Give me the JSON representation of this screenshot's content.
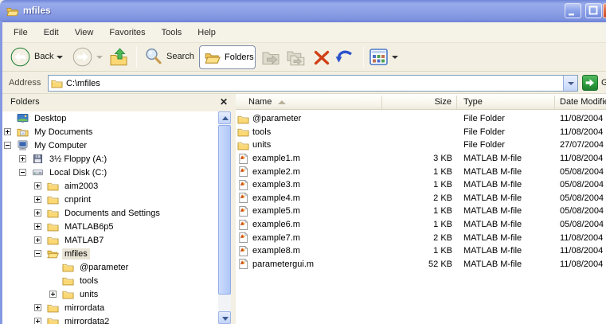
{
  "window": {
    "title": "mfiles"
  },
  "menu": {
    "items": [
      "File",
      "Edit",
      "View",
      "Favorites",
      "Tools",
      "Help"
    ]
  },
  "toolbar": {
    "back_label": "Back",
    "search_label": "Search",
    "folders_label": "Folders",
    "buttons": [
      "back",
      "forward",
      "up",
      "search",
      "folders",
      "move-to",
      "copy-to",
      "delete",
      "undo",
      "views"
    ]
  },
  "address_bar": {
    "label": "Address",
    "path": "C:\\mfiles",
    "go_label": "Go"
  },
  "folders_pane": {
    "title": "Folders",
    "close_icon": "✕",
    "tree": [
      {
        "label": "Desktop",
        "level": 0,
        "expander": null,
        "icon": "desktop",
        "selected": false
      },
      {
        "label": "My Documents",
        "level": 1,
        "expander": "+",
        "icon": "my-documents",
        "selected": false
      },
      {
        "label": "My Computer",
        "level": 1,
        "expander": "-",
        "icon": "my-computer",
        "selected": false
      },
      {
        "label": "3½ Floppy (A:)",
        "level": 2,
        "expander": "+",
        "icon": "floppy-drive",
        "selected": false
      },
      {
        "label": "Local Disk (C:)",
        "level": 2,
        "expander": "-",
        "icon": "local-disk",
        "selected": false
      },
      {
        "label": "aim2003",
        "level": 3,
        "expander": "+",
        "icon": "folder",
        "selected": false
      },
      {
        "label": "cnprint",
        "level": 3,
        "expander": "+",
        "icon": "folder",
        "selected": false
      },
      {
        "label": "Documents and Settings",
        "level": 3,
        "expander": "+",
        "icon": "folder",
        "selected": false
      },
      {
        "label": "MATLAB6p5",
        "level": 3,
        "expander": "+",
        "icon": "folder",
        "selected": false
      },
      {
        "label": "MATLAB7",
        "level": 3,
        "expander": "+",
        "icon": "folder",
        "selected": false
      },
      {
        "label": "mfiles",
        "level": 3,
        "expander": "-",
        "icon": "folder-open",
        "selected": true
      },
      {
        "label": "@parameter",
        "level": 4,
        "expander": null,
        "icon": "folder",
        "selected": false
      },
      {
        "label": "tools",
        "level": 4,
        "expander": null,
        "icon": "folder",
        "selected": false
      },
      {
        "label": "units",
        "level": 4,
        "expander": "+",
        "icon": "folder",
        "selected": false
      },
      {
        "label": "mirrordata",
        "level": 3,
        "expander": "+",
        "icon": "folder",
        "selected": false
      },
      {
        "label": "mirrordata2",
        "level": 3,
        "expander": "+",
        "icon": "folder",
        "selected": false
      }
    ]
  },
  "file_list": {
    "columns": [
      "Name",
      "Size",
      "Type",
      "Date Modified"
    ],
    "sort": {
      "column": "Name",
      "direction": "ascending"
    },
    "rows": [
      {
        "name": "@parameter",
        "size": "",
        "type": "File Folder",
        "date": "11/08/2004",
        "icon": "folder"
      },
      {
        "name": "tools",
        "size": "",
        "type": "File Folder",
        "date": "11/08/2004",
        "icon": "folder"
      },
      {
        "name": "units",
        "size": "",
        "type": "File Folder",
        "date": "27/07/2004",
        "icon": "folder"
      },
      {
        "name": "example1.m",
        "size": "3 KB",
        "type": "MATLAB M-file",
        "date": "11/08/2004",
        "icon": "matlab-m-file"
      },
      {
        "name": "example2.m",
        "size": "1 KB",
        "type": "MATLAB M-file",
        "date": "05/08/2004",
        "icon": "matlab-m-file"
      },
      {
        "name": "example3.m",
        "size": "1 KB",
        "type": "MATLAB M-file",
        "date": "05/08/2004",
        "icon": "matlab-m-file"
      },
      {
        "name": "example4.m",
        "size": "2 KB",
        "type": "MATLAB M-file",
        "date": "05/08/2004",
        "icon": "matlab-m-file"
      },
      {
        "name": "example5.m",
        "size": "1 KB",
        "type": "MATLAB M-file",
        "date": "05/08/2004",
        "icon": "matlab-m-file"
      },
      {
        "name": "example6.m",
        "size": "1 KB",
        "type": "MATLAB M-file",
        "date": "05/08/2004",
        "icon": "matlab-m-file"
      },
      {
        "name": "example7.m",
        "size": "2 KB",
        "type": "MATLAB M-file",
        "date": "11/08/2004",
        "icon": "matlab-m-file"
      },
      {
        "name": "example8.m",
        "size": "1 KB",
        "type": "MATLAB M-file",
        "date": "11/08/2004",
        "icon": "matlab-m-file"
      },
      {
        "name": "parametergui.m",
        "size": "52 KB",
        "type": "MATLAB M-file",
        "date": "11/08/2004",
        "icon": "matlab-m-file"
      }
    ]
  },
  "colors": {
    "titlebar_blue": "#8A9EE4",
    "inactive_selection": "#E9E5D6",
    "go_green": "#2E9E3E",
    "delete_red": "#D04018",
    "undo_blue": "#2C52CC"
  }
}
